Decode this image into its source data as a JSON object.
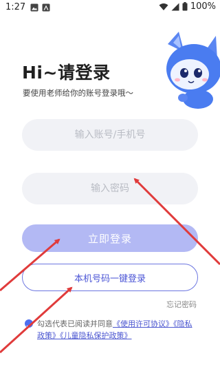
{
  "status": {
    "time": "1:27",
    "battery": "100%",
    "left_icons": [
      "image-icon",
      "font-icon"
    ],
    "right_icons": [
      "wifi-icon",
      "signal-icon",
      "battery-icon"
    ]
  },
  "header": {
    "title": "Hi~请登录",
    "subtitle": "要使用老师给你的账号登录哦～"
  },
  "form": {
    "account_placeholder": "输入账号/手机号",
    "account_value": "",
    "password_placeholder": "输入密码",
    "password_value": "",
    "login_label": "立即登录",
    "phone_login_label": "本机号码一键登录",
    "forgot_label": "忘记密码"
  },
  "agreement": {
    "checked": true,
    "prefix": "勾选代表已阅读并同意",
    "terms_link": "《使用许可协议》",
    "privacy_link": "《隐私政策》",
    "children_link": "《儿童隐私保护政策》"
  },
  "colors": {
    "primary": "#b3b9f4",
    "accent": "#4c56d6",
    "field_bg": "#f1f2f6",
    "annotation_arrow": "#e03b3b"
  }
}
